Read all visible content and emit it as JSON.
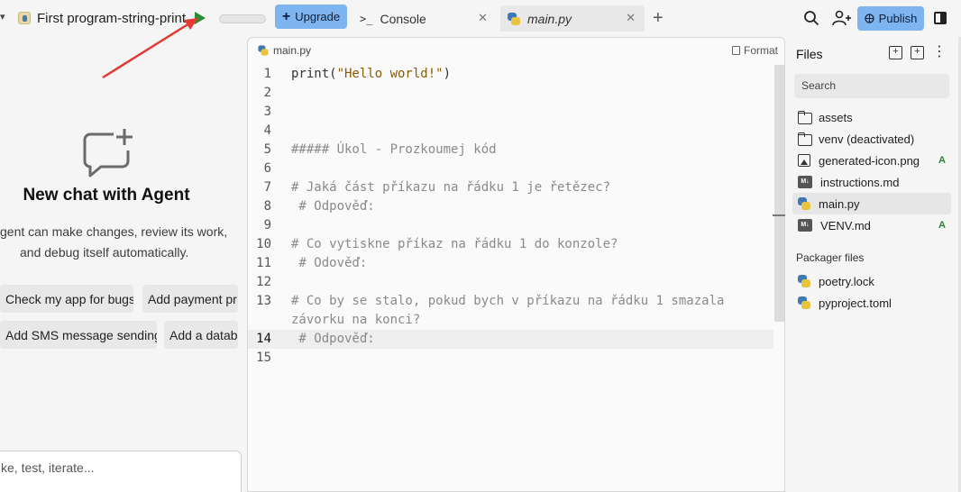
{
  "header": {
    "project_title": "First program-string-print",
    "upgrade_label": "Upgrade",
    "publish_label": "Publish",
    "tabs": [
      {
        "label": "Console",
        "close": "✕"
      },
      {
        "label": "main.py",
        "close": "✕"
      }
    ],
    "new_tab_symbol": "+",
    "caret": "▾"
  },
  "agent": {
    "title": "New chat with Agent",
    "description_line1": "gent can make changes, review its work,",
    "description_line2": "and debug itself automatically.",
    "suggestions": [
      "Check my app for bugs",
      "Add payment pr",
      "Add SMS message sending",
      "Add a datab"
    ],
    "input_placeholder": "ke, test, iterate..."
  },
  "editor": {
    "file_label": "main.py",
    "format_label": "Format",
    "active_line": 14,
    "lines": [
      {
        "n": "1",
        "text": "print(\"Hello world!\")"
      },
      {
        "n": "2",
        "text": ""
      },
      {
        "n": "3",
        "text": ""
      },
      {
        "n": "4",
        "text": ""
      },
      {
        "n": "5",
        "text": "##### Úkol - Prozkoumej kód"
      },
      {
        "n": "6",
        "text": ""
      },
      {
        "n": "7",
        "text": "# Jaká část příkazu na řádku 1 je řetězec?"
      },
      {
        "n": "8",
        "text": " # Odpověď:"
      },
      {
        "n": "9",
        "text": ""
      },
      {
        "n": "10",
        "text": "# Co vytiskne příkaz na řádku 1 do konzole?"
      },
      {
        "n": "11",
        "text": " # Odověď:"
      },
      {
        "n": "12",
        "text": ""
      },
      {
        "n": "13",
        "text": "# Co by se stalo, pokud bych v příkazu na řádku 1 smazala"
      },
      {
        "n": "",
        "text": "závorku na konci?"
      },
      {
        "n": "14",
        "text": " # Odpověď:"
      },
      {
        "n": "15",
        "text": ""
      }
    ]
  },
  "files": {
    "title": "Files",
    "search_placeholder": "Search",
    "items": [
      {
        "name": "assets",
        "icon": "folder-icon",
        "badge": ""
      },
      {
        "name": "venv (deactivated)",
        "icon": "folder-icon",
        "badge": ""
      },
      {
        "name": "generated-icon.png",
        "icon": "image-icon",
        "badge": "A"
      },
      {
        "name": "instructions.md",
        "icon": "markdown-icon",
        "badge": ""
      },
      {
        "name": "main.py",
        "icon": "python-icon",
        "badge": ""
      },
      {
        "name": "VENV.md",
        "icon": "markdown-icon",
        "badge": "A"
      }
    ],
    "packager_label": "Packager files",
    "packager_items": [
      {
        "name": "poetry.lock",
        "icon": "python-icon"
      },
      {
        "name": "pyproject.toml",
        "icon": "python-icon"
      }
    ],
    "md_icon_text": "M↓",
    "kebab": "⋮"
  },
  "colors": {
    "accent_button": "#7eb4f0",
    "run_green": "#2e8b32",
    "annotation_arrow": "#e53935",
    "added_badge": "#2e7d32"
  }
}
